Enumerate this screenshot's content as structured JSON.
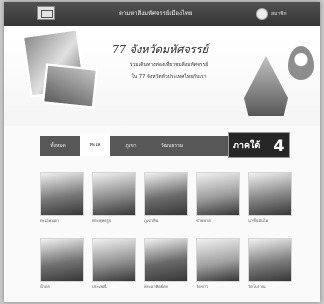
{
  "header": {
    "site_name": "ตามหาสิ่งมหัศจรรย์เมืองไทย",
    "user_name": "สมาชิก"
  },
  "banner": {
    "title": "77 จังหวัดมหัศจรรย์",
    "line1": "ร่วมเดินทางท่องเที่ยวชมสิ่งมหัศจรรย์",
    "line2": "ใน 77 จังหวัดทั่วประเทศไทยกับเรา"
  },
  "tabs": [
    {
      "label": "ทั้งหมด"
    },
    {
      "label": "ทะเล"
    },
    {
      "label": "ภูเขา"
    },
    {
      "label": "วัฒนธรรม"
    }
  ],
  "counter": {
    "label": "ภาคใต้",
    "value": "4"
  },
  "cards": [
    {
      "caption": "ทะเลหมอก",
      "tone": "#7a7a7a"
    },
    {
      "caption": "พระพุทธรูป",
      "tone": "#8c8c8c"
    },
    {
      "caption": "ภูเขาหิน",
      "tone": "#6e6e6e"
    },
    {
      "caption": "ชายหาด",
      "tone": "#9a9a9a"
    },
    {
      "caption": "นาขั้นบันได",
      "tone": "#858585"
    },
    {
      "caption": "น้ำตก",
      "tone": "#747474"
    },
    {
      "caption": "ประเพณี",
      "tone": "#929292"
    },
    {
      "caption": "พระอาทิตย์ตก",
      "tone": "#6a6a6a"
    },
    {
      "caption": "วัดขาว",
      "tone": "#a0a0a0"
    },
    {
      "caption": "วัดโบราณ",
      "tone": "#7e7e7e"
    }
  ]
}
